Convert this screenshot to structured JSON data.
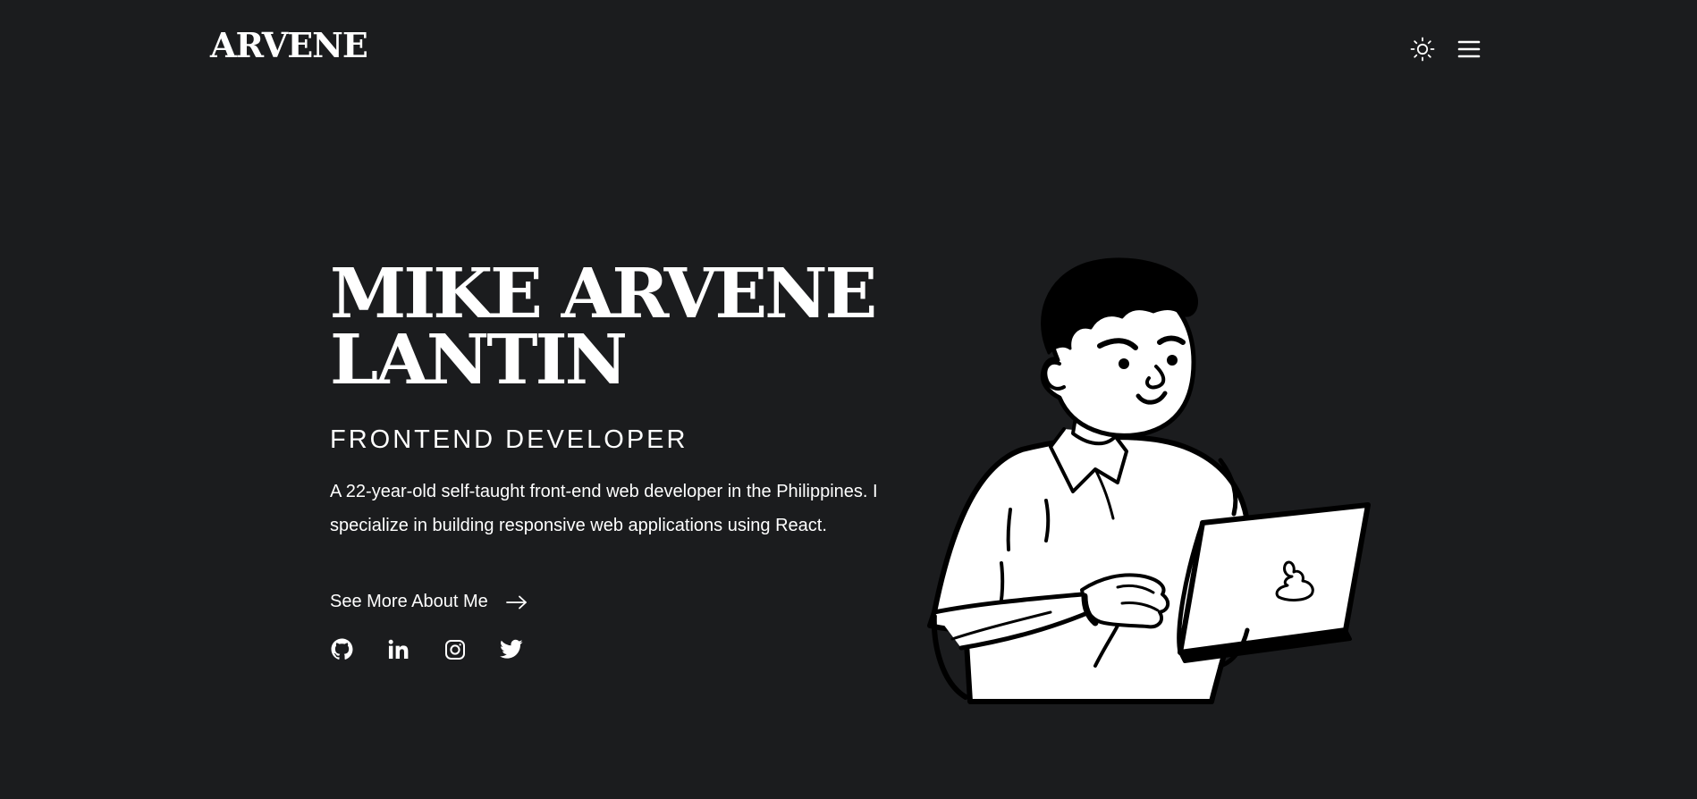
{
  "header": {
    "logo": "ARVENE",
    "theme_toggle_icon": "sun-icon",
    "menu_icon": "hamburger-menu-icon"
  },
  "hero": {
    "name_line1": "MIKE ARVENE",
    "name_line2": "LANTIN",
    "role": "FRONTEND DEVELOPER",
    "bio": "A 22-year-old self-taught front-end web developer in the Philippines. I specialize in building responsive web applications using React.",
    "cta_label": "See More About Me",
    "cta_icon": "arrow-right-icon"
  },
  "socials": [
    {
      "icon": "github-icon"
    },
    {
      "icon": "linkedin-icon"
    },
    {
      "icon": "instagram-icon"
    },
    {
      "icon": "twitter-icon"
    }
  ],
  "illustration": {
    "description_icon": "developer-with-laptop-illustration"
  },
  "colors": {
    "background": "#1b1c1e",
    "foreground": "#ffffff"
  }
}
